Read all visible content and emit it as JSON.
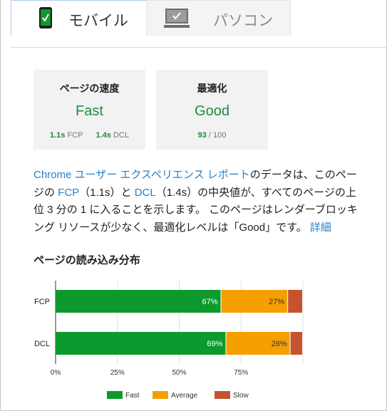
{
  "tabs": [
    {
      "label": "モバイル",
      "active": true,
      "icon": "smartphone-icon"
    },
    {
      "label": "パソコン",
      "active": false,
      "icon": "monitor-icon"
    }
  ],
  "cards": {
    "speed": {
      "title": "ページの速度",
      "value": "Fast",
      "fcp_value": "1.1s",
      "fcp_label": "FCP",
      "dcl_value": "1.4s",
      "dcl_label": "DCL"
    },
    "optimization": {
      "title": "最適化",
      "value": "Good",
      "score": "93",
      "max": "/ 100"
    }
  },
  "description": {
    "link_report": "Chrome ユーザー エクスペリエンス レポート",
    "text1": "のデータは、このページの ",
    "link_fcp": "FCP",
    "text2": "（1.1s）と ",
    "link_dcl": "DCL",
    "text3": "（1.4s）の中央値が、すべてのページの上位 3 分の 1 に入ることを示します。 このページはレンダーブロッキング リソースが少なく、最適化レベルは「Good」です。 ",
    "link_details": "詳細"
  },
  "chart_title": "ページの読み込み分布",
  "colors": {
    "fast": "#0c9a2e",
    "average": "#f5a000",
    "slow": "#c4532e",
    "accent_green": "#1e8e3e",
    "link": "#2a7ec5"
  },
  "chart_data": {
    "type": "bar",
    "orientation": "horizontal",
    "stacked": true,
    "categories": [
      "FCP",
      "DCL"
    ],
    "series": [
      {
        "name": "Fast",
        "values": [
          67,
          69
        ],
        "labels": [
          "67%",
          "69%"
        ]
      },
      {
        "name": "Average",
        "values": [
          27,
          26
        ],
        "labels": [
          "27%",
          "26%"
        ]
      },
      {
        "name": "Slow",
        "values": [
          6,
          5
        ],
        "labels": [
          "",
          ""
        ]
      }
    ],
    "xlim": [
      0,
      100
    ],
    "xticks": [
      "0%",
      "25%",
      "50%",
      "75%"
    ],
    "xtick_values": [
      0,
      25,
      50,
      75
    ],
    "legend_position": "bottom",
    "grid": true
  }
}
